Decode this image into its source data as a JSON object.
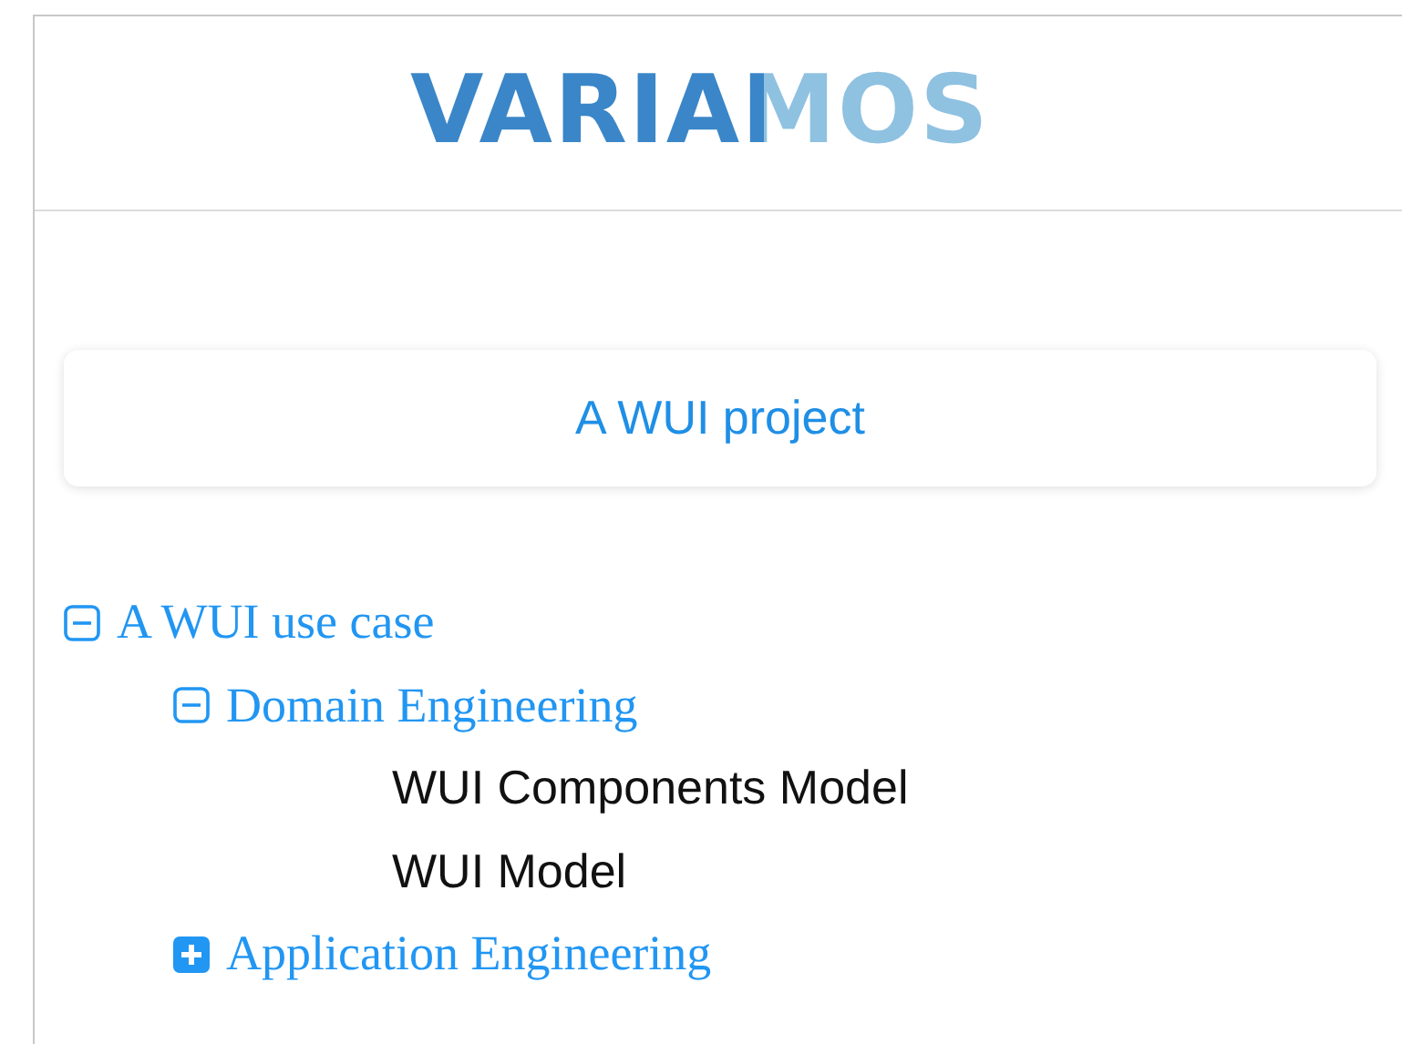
{
  "logo": {
    "text": "VARIAMOS"
  },
  "project": {
    "title": "A WUI project"
  },
  "tree": [
    {
      "kind": "folder",
      "label": "A WUI use case",
      "expanded": true,
      "children": [
        {
          "kind": "folder",
          "label": "Domain Engineering",
          "expanded": true,
          "children": [
            {
              "kind": "model",
              "label": "WUI Components Model"
            },
            {
              "kind": "model",
              "label": "WUI Model"
            }
          ]
        },
        {
          "kind": "folder",
          "label": "Application Engineering",
          "expanded": false
        }
      ]
    }
  ]
}
